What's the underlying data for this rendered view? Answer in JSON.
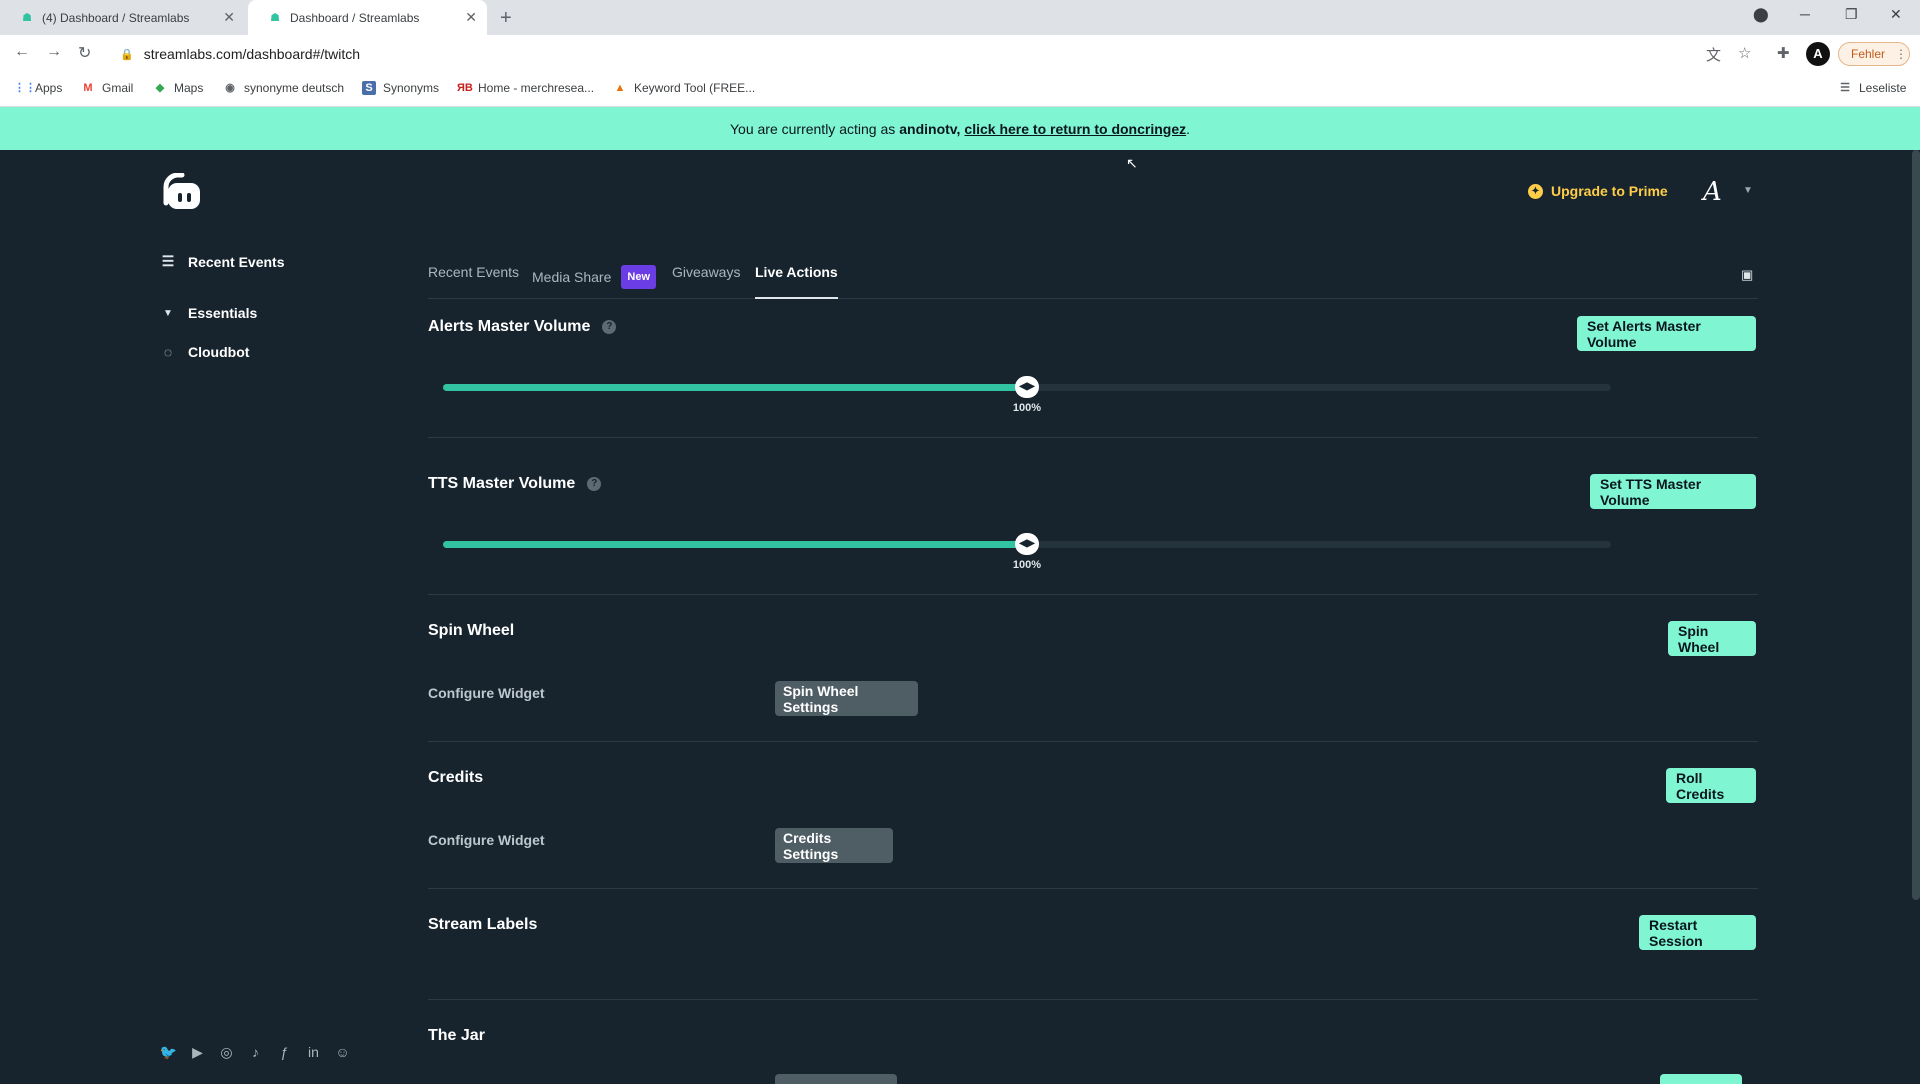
{
  "browser": {
    "tabs": [
      {
        "title": "(4) Dashboard / Streamlabs"
      },
      {
        "title": "Dashboard / Streamlabs"
      }
    ],
    "url": "streamlabs.com/dashboard#/twitch",
    "profile_button": "Fehler",
    "bookmarks": [
      "Apps",
      "Gmail",
      "Maps",
      "synonyme deutsch",
      "Synonyms",
      "Home - merchresea...",
      "Keyword Tool (FREE..."
    ],
    "reading_list": "Leseliste"
  },
  "banner": {
    "prefix": "You are currently acting as",
    "user": "andinotv,",
    "link": "click here to return to doncringez",
    "suffix": "."
  },
  "header": {
    "upgrade": "Upgrade to Prime"
  },
  "sidebar": {
    "recent_events": "Recent Events",
    "essentials": "Essentials",
    "cloudbot": "Cloudbot"
  },
  "tabs": {
    "recent_events": "Recent Events",
    "media_share": "Media Share",
    "new_badge": "New",
    "giveaways": "Giveaways",
    "live_actions": "Live Actions"
  },
  "alerts": {
    "title": "Alerts Master Volume",
    "button": "Set Alerts Master Volume",
    "value_label": "100%",
    "level": 0.5
  },
  "tts": {
    "title": "TTS Master Volume",
    "button": "Set TTS Master Volume",
    "value_label": "100%",
    "level": 0.5
  },
  "spin_wheel": {
    "title": "Spin Wheel",
    "button": "Spin Wheel",
    "configure": "Configure Widget",
    "settings": "Spin Wheel Settings"
  },
  "credits": {
    "title": "Credits",
    "button": "Roll Credits",
    "configure": "Configure Widget",
    "settings": "Credits Settings"
  },
  "stream_labels": {
    "title": "Stream Labels",
    "button": "Restart Session"
  },
  "jar": {
    "title": "The Jar"
  }
}
